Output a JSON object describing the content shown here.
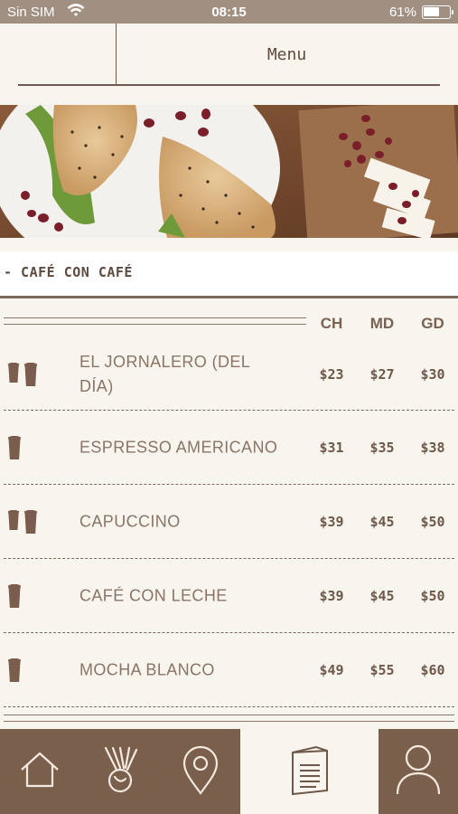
{
  "status_bar": {
    "carrier": "Sin SIM",
    "time": "08:15",
    "battery": "61%"
  },
  "header": {
    "title": "Menu"
  },
  "section": {
    "title": "- CAFÉ CON CAFÉ"
  },
  "table": {
    "columns": [
      "CH",
      "MD",
      "GD"
    ],
    "rows": [
      {
        "name": "EL JORNALERO (DEL DÍA)",
        "icons": 2,
        "prices": [
          "$23",
          "$27",
          "$30"
        ]
      },
      {
        "name": "ESPRESSO AMERICANO",
        "icons": 1,
        "prices": [
          "$31",
          "$35",
          "$38"
        ]
      },
      {
        "name": "CAPUCCINO",
        "icons": 2,
        "prices": [
          "$39",
          "$45",
          "$50"
        ]
      },
      {
        "name": "CAFÉ CON LECHE",
        "icons": 1,
        "prices": [
          "$39",
          "$45",
          "$50"
        ]
      },
      {
        "name": "MOCHA BLANCO",
        "icons": 1,
        "prices": [
          "$49",
          "$55",
          "$60"
        ]
      }
    ]
  },
  "tabbar": {
    "items": [
      {
        "icon": "home-icon",
        "active": false
      },
      {
        "icon": "coffee-beans-icon",
        "active": false
      },
      {
        "icon": "location-pin-icon",
        "active": false
      },
      {
        "icon": "menu-document-icon",
        "active": true
      },
      {
        "icon": "user-profile-icon",
        "active": false
      }
    ]
  },
  "colors": {
    "accent": "#7b5f4d",
    "background": "#f8f4ee",
    "status_bar": "#a18f82"
  }
}
